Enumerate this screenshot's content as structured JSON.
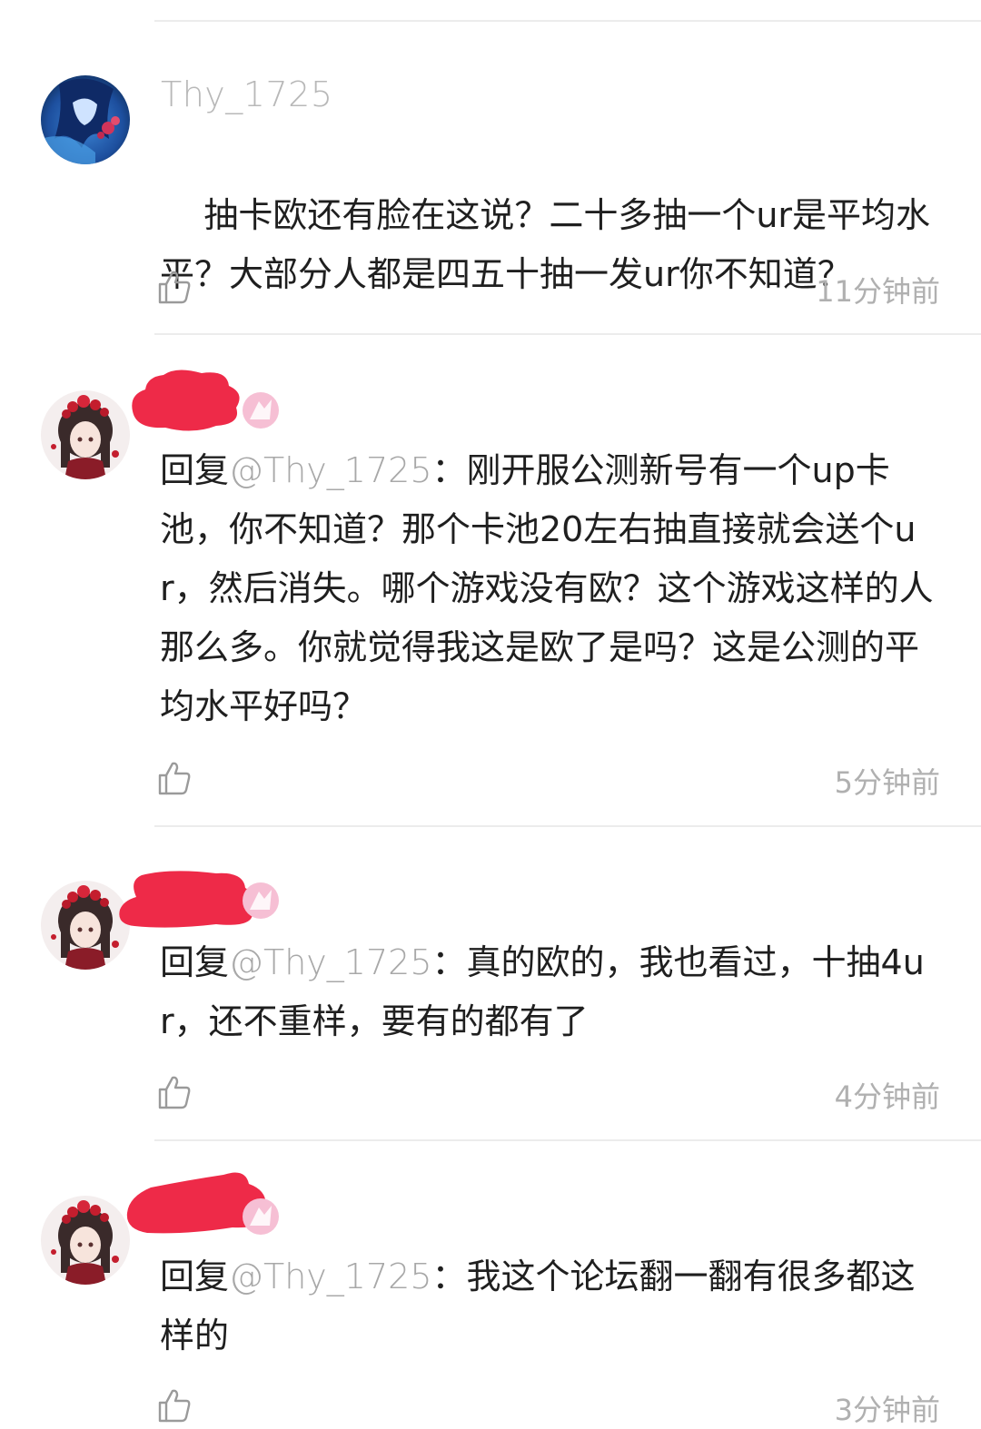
{
  "comments": [
    {
      "username": "Thy_1725",
      "text": "抽卡欧还有脸在这说？二十多抽一个ur是平均水平？大部分人都是四五十抽一发ur你不知道？",
      "time": "11分钟前",
      "like_icon": "thumbs-up-icon"
    },
    {
      "username": "",
      "reply_prefix": "回复",
      "mention": "@Thy_1725",
      "text": "：刚开服公测新号有一个up卡池，你不知道？那个卡池20左右抽直接就会送个ur，然后消失。哪个游戏没有欧？这个游戏这样的人那么多。你就觉得我这是欧了是吗？这是公测的平均水平好吗？",
      "time": "5分钟前",
      "like_icon": "thumbs-up-icon"
    },
    {
      "username": "",
      "reply_prefix": "回复",
      "mention": "@Thy_1725",
      "text": "：真的欧的，我也看过，十抽4ur，还不重样，要有的都有了",
      "time": "4分钟前",
      "like_icon": "thumbs-up-icon"
    },
    {
      "username": "",
      "reply_prefix": "回复",
      "mention": "@Thy_1725",
      "text": "：我这个论坛翻一翻有很多都这样的",
      "time": "3分钟前",
      "like_icon": "thumbs-up-icon"
    }
  ],
  "colors": {
    "redaction": "#ee2a48",
    "username": "#b8b8b8",
    "mention": "#a8a8a8",
    "timestamp": "#b0b0b0",
    "badge": "#f6bfd4"
  }
}
